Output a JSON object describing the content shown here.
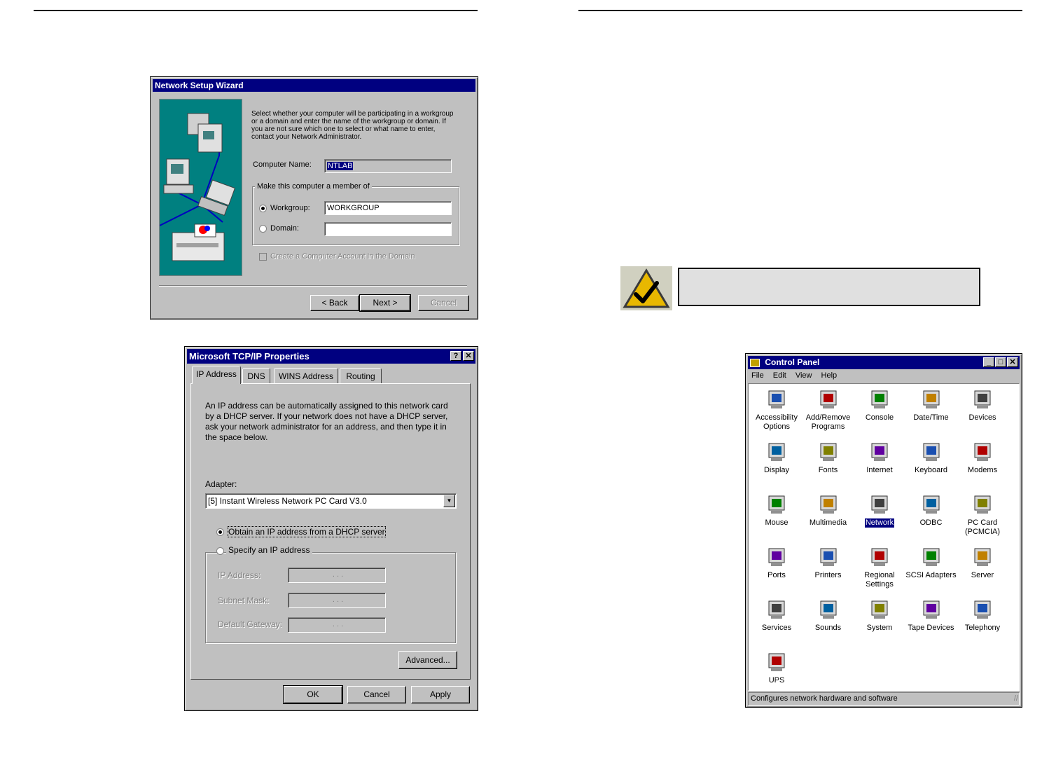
{
  "wizard": {
    "title": "Network Setup Wizard",
    "description": [
      "Select whether your computer will be participating in a workgroup",
      "or a domain and enter the name of the workgroup or domain.  If",
      "you are not sure which one to select or what name to enter,",
      "contact your Network Administrator."
    ],
    "computer_name_label": "Computer Name:",
    "computer_name_value": "NTLAB",
    "group_label": "Make this computer a member of",
    "workgroup_label": "Workgroup:",
    "workgroup_value": "WORKGROUP",
    "domain_label": "Domain:",
    "domain_value": "",
    "selected_membership": "workgroup",
    "create_account_label": "Create a Computer Account in the Domain",
    "back_label": "< Back",
    "next_label": "Next >",
    "cancel_label": "Cancel"
  },
  "tcpip": {
    "title": "Microsoft TCP/IP Properties",
    "help_glyph": "?",
    "close_glyph": "✕",
    "tabs": [
      "IP Address",
      "DNS",
      "WINS Address",
      "Routing"
    ],
    "active_tab": "IP Address",
    "description": [
      "An IP address can be automatically assigned to this network card",
      "by a DHCP server.  If your network does not have a DHCP server,",
      "ask your network administrator for an address, and then type it in",
      "the space below."
    ],
    "adapter_label": "Adapter:",
    "adapter_value": "[5] Instant Wireless Network PC Card V3.0",
    "obtain_label": "Obtain an IP address from a DHCP server",
    "specify_label": "Specify an IP address",
    "selected_mode": "obtain",
    "ip_label": "IP Address:",
    "subnet_label": "Subnet Mask:",
    "gateway_label": "Default Gateway:",
    "ip_dots": ".        .        .",
    "advanced_label": "Advanced...",
    "ok_label": "OK",
    "cancel_label": "Cancel",
    "apply_label": "Apply"
  },
  "note": {
    "icon": "checkmark-warning-icon",
    "text": ""
  },
  "control_panel": {
    "title": "Control Panel",
    "menu": [
      "File",
      "Edit",
      "View",
      "Help"
    ],
    "window_buttons": [
      "_",
      "□",
      "✕"
    ],
    "items": [
      {
        "label": "Accessibility Options",
        "icon": "accessibility-icon"
      },
      {
        "label": "Add/Remove Programs",
        "icon": "add-remove-programs-icon"
      },
      {
        "label": "Console",
        "icon": "console-icon"
      },
      {
        "label": "Date/Time",
        "icon": "date-time-icon"
      },
      {
        "label": "Devices",
        "icon": "devices-icon"
      },
      {
        "label": "Display",
        "icon": "display-icon"
      },
      {
        "label": "Fonts",
        "icon": "fonts-icon"
      },
      {
        "label": "Internet",
        "icon": "internet-icon"
      },
      {
        "label": "Keyboard",
        "icon": "keyboard-icon"
      },
      {
        "label": "Modems",
        "icon": "modems-icon"
      },
      {
        "label": "Mouse",
        "icon": "mouse-icon"
      },
      {
        "label": "Multimedia",
        "icon": "multimedia-icon"
      },
      {
        "label": "Network",
        "icon": "network-icon",
        "selected": true
      },
      {
        "label": "ODBC",
        "icon": "odbc-icon"
      },
      {
        "label": "PC Card (PCMCIA)",
        "icon": "pc-card-icon"
      },
      {
        "label": "Ports",
        "icon": "ports-icon"
      },
      {
        "label": "Printers",
        "icon": "printers-icon"
      },
      {
        "label": "Regional Settings",
        "icon": "regional-settings-icon"
      },
      {
        "label": "SCSI Adapters",
        "icon": "scsi-adapters-icon"
      },
      {
        "label": "Server",
        "icon": "server-icon"
      },
      {
        "label": "Services",
        "icon": "services-icon"
      },
      {
        "label": "Sounds",
        "icon": "sounds-icon"
      },
      {
        "label": "System",
        "icon": "system-icon"
      },
      {
        "label": "Tape Devices",
        "icon": "tape-devices-icon"
      },
      {
        "label": "Telephony",
        "icon": "telephony-icon"
      },
      {
        "label": "UPS",
        "icon": "ups-icon"
      }
    ],
    "status_text": "Configures network hardware and software"
  }
}
